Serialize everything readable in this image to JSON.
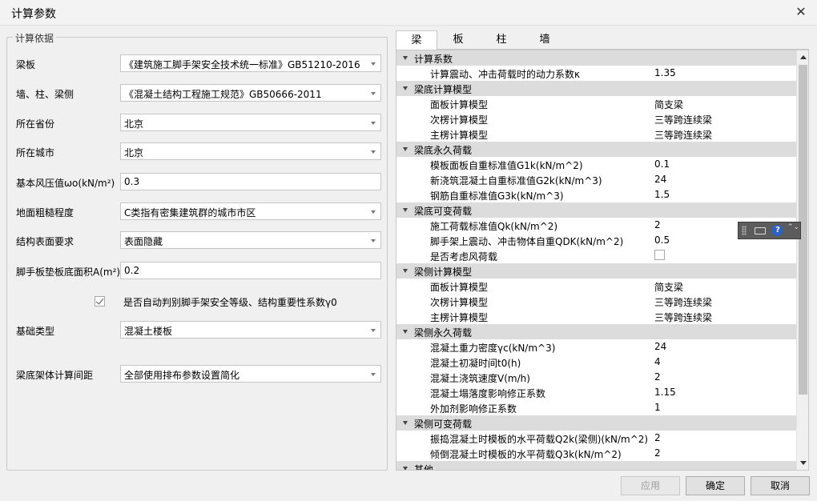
{
  "window": {
    "title": "计算参数",
    "close_glyph": "✕"
  },
  "left": {
    "group_title": "计算依据",
    "fields": [
      {
        "label": "梁板",
        "value": "《建筑施工脚手架安全技术统一标准》GB51210-2016"
      },
      {
        "label": "墙、柱、梁侧",
        "value": "《混凝土结构工程施工规范》GB50666-2011"
      },
      {
        "label": "所在省份",
        "value": "北京"
      },
      {
        "label": "所在城市",
        "value": "北京"
      },
      {
        "label": "基本风压值ωo(kN/m²)",
        "value": "0.3"
      },
      {
        "label": "地面粗糙程度",
        "value": "C类指有密集建筑群的城市市区"
      },
      {
        "label": "结构表面要求",
        "value": "表面隐藏"
      },
      {
        "label": "脚手板垫板底面积A(m²)",
        "value": "0.2"
      },
      {
        "label": "基础类型",
        "value": "混凝土楼板"
      },
      {
        "label": "梁底架体计算间距",
        "value": "全部使用排布参数设置简化"
      }
    ],
    "auto_check": {
      "label": "是否自动判别脚手架安全等级、结构重要性系数γ0",
      "checked": true
    }
  },
  "tabs": [
    "梁",
    "板",
    "柱",
    "墙"
  ],
  "grid": {
    "rows": [
      {
        "type": "cat",
        "text": "计算系数"
      },
      {
        "type": "prop",
        "name": "计算震动、冲击荷载时的动力系数κ",
        "value": "1.35"
      },
      {
        "type": "cat",
        "text": "梁底计算模型"
      },
      {
        "type": "prop",
        "name": "面板计算模型",
        "value": "简支梁"
      },
      {
        "type": "prop",
        "name": "次楞计算模型",
        "value": "三等跨连续梁"
      },
      {
        "type": "prop",
        "name": "主楞计算模型",
        "value": "三等跨连续梁"
      },
      {
        "type": "cat",
        "text": "梁底永久荷载"
      },
      {
        "type": "prop",
        "name": "模板面板自重标准值G1k(kN/m^2)",
        "value": "0.1"
      },
      {
        "type": "prop",
        "name": "新浇筑混凝土自重标准值G2k(kN/m^3)",
        "value": "24"
      },
      {
        "type": "prop",
        "name": "钢筋自重标准值G3k(kN/m^3)",
        "value": "1.5"
      },
      {
        "type": "cat",
        "text": "梁底可变荷载"
      },
      {
        "type": "prop",
        "name": "施工荷载标准值Qk(kN/m^2)",
        "value": "2"
      },
      {
        "type": "prop",
        "name": "脚手架上震动、冲击物体自重QDK(kN/m^2)",
        "value": "0.5"
      },
      {
        "type": "check",
        "name": "是否考虑风荷载",
        "checked": false
      },
      {
        "type": "cat",
        "text": "梁侧计算模型"
      },
      {
        "type": "prop",
        "name": "面板计算模型",
        "value": "简支梁"
      },
      {
        "type": "prop",
        "name": "次楞计算模型",
        "value": "三等跨连续梁"
      },
      {
        "type": "prop",
        "name": "主楞计算模型",
        "value": "三等跨连续梁"
      },
      {
        "type": "cat",
        "text": "梁侧永久荷载"
      },
      {
        "type": "prop",
        "name": "混凝土重力密度γc(kN/m^3)",
        "value": "24"
      },
      {
        "type": "prop",
        "name": "混凝土初凝时间t0(h)",
        "value": "4"
      },
      {
        "type": "prop",
        "name": "混凝土浇筑速度V(m/h)",
        "value": "2"
      },
      {
        "type": "prop",
        "name": "混凝土塌落度影响修正系数",
        "value": "1.15"
      },
      {
        "type": "prop",
        "name": "外加剂影响修正系数",
        "value": "1"
      },
      {
        "type": "cat",
        "text": "梁侧可变荷载"
      },
      {
        "type": "prop",
        "name": "振捣混凝土时模板的水平荷载Q2k(梁侧)(kN/m^2)",
        "value": "2"
      },
      {
        "type": "prop",
        "name": "倾倒混凝土时模板的水平荷载Q3k(kN/m^2)",
        "value": "2"
      },
      {
        "type": "cat",
        "text": "其他"
      }
    ]
  },
  "ime_toolbar": {
    "help_glyph": "?",
    "options_glyph": "⌃⌄"
  },
  "buttons": {
    "apply": "应用",
    "ok": "确定",
    "cancel": "取消"
  }
}
